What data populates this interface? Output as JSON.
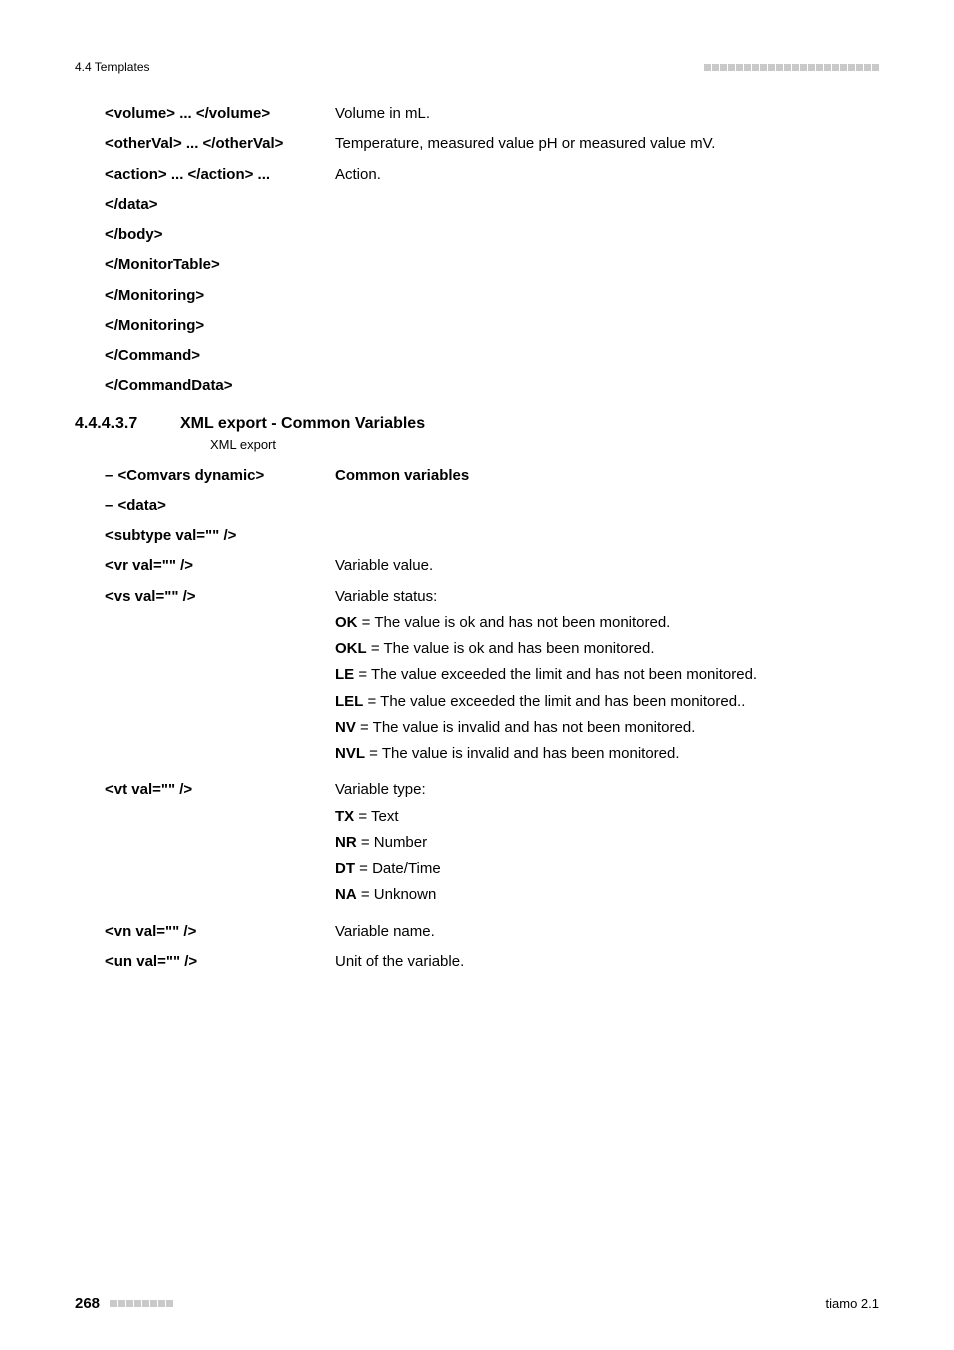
{
  "header": {
    "left": "4.4 Templates"
  },
  "top_rows": [
    {
      "l": "<volume> ... </volume>",
      "r": "Volume in mL."
    },
    {
      "l": "<otherVal> ... </otherVal>",
      "r": "Temperature, measured value pH or measured value mV."
    },
    {
      "l": "<action> ... </action> ...",
      "r": "Action."
    },
    {
      "l": "</data>",
      "r": ""
    },
    {
      "l": "</body>",
      "r": ""
    },
    {
      "l": "</MonitorTable>",
      "r": ""
    },
    {
      "l": "</Monitoring>",
      "r": ""
    },
    {
      "l": "</Monitoring>",
      "r": ""
    },
    {
      "l": "</Command>",
      "r": ""
    },
    {
      "l": "</CommandData>",
      "r": ""
    }
  ],
  "section": {
    "num": "4.4.4.3.7",
    "title": "XML export - Common Variables",
    "sub": "XML export"
  },
  "rows2": [
    {
      "l": "– <Comvars dynamic>",
      "r_bold": "Common variables"
    },
    {
      "l": "– <data>",
      "r": ""
    },
    {
      "l": "<subtype val=\"\" />",
      "r": ""
    },
    {
      "l": "<vr val=\"\" />",
      "r": "Variable value."
    }
  ],
  "vs": {
    "l": "<vs val=\"\" />",
    "lead": "Variable status:",
    "items": [
      {
        "b": "OK",
        "t": " = The value is ok and has not been monitored."
      },
      {
        "b": "OKL",
        "t": " = The value is ok and has been monitored."
      },
      {
        "b": "LE",
        "t": " = The value exceeded the limit and has not been monitored."
      },
      {
        "b": "LEL",
        "t": " = The value exceeded the limit and has been monitored.."
      },
      {
        "b": "NV",
        "t": " = The value is invalid and has not been monitored."
      },
      {
        "b": "NVL",
        "t": " = The value is invalid and has been monitored."
      }
    ]
  },
  "vt": {
    "l": "<vt val=\"\" />",
    "lead": "Variable type:",
    "items": [
      {
        "b": "TX",
        "t": " = Text"
      },
      {
        "b": "NR",
        "t": " = Number"
      },
      {
        "b": "DT",
        "t": " = Date/Time"
      },
      {
        "b": "NA",
        "t": " = Unknown"
      }
    ]
  },
  "rows3": [
    {
      "l": "<vn val=\"\" />",
      "r": "Variable name."
    },
    {
      "l": "<un val=\"\" />",
      "r": "Unit of the variable."
    }
  ],
  "footer": {
    "page": "268",
    "right": "tiamo 2.1"
  }
}
